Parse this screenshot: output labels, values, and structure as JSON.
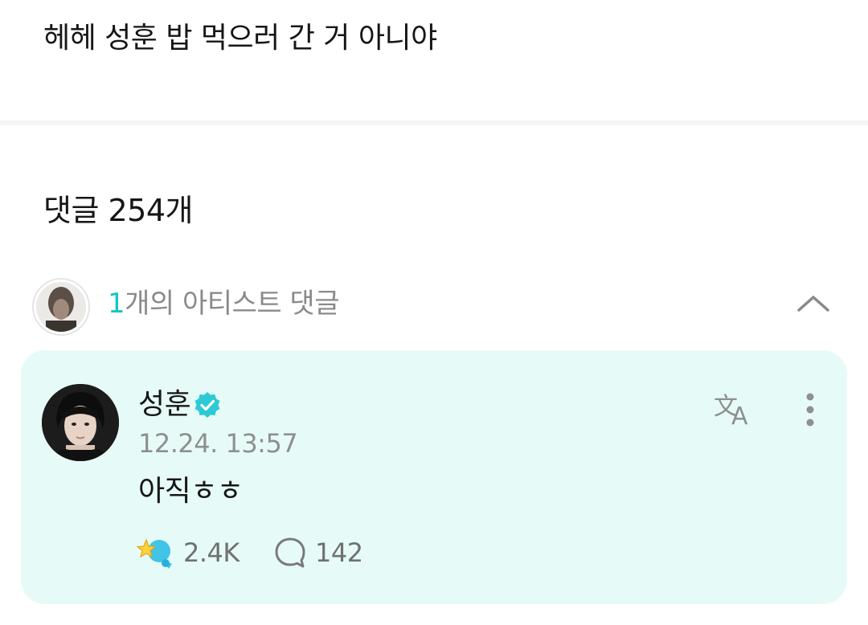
{
  "post": {
    "text": "헤헤 성훈 밥 먹으러 간 거 아니야"
  },
  "comments_section": {
    "header": "댓글 254개",
    "artist_group": {
      "count": "1",
      "label": "개의 아티스트 댓글"
    }
  },
  "artist_comment": {
    "author": "성훈",
    "timestamp": "12.24. 13:57",
    "body": "아직ㅎㅎ",
    "cheer_count": "2.4K",
    "reply_count": "142",
    "accent_color": "#12c6c6",
    "card_background": "#e6fbf7"
  },
  "icons": {
    "verified": "verified-check-icon",
    "translate": "translate-icon",
    "more": "more-vertical-icon",
    "collapse": "chevron-up-icon",
    "cheer": "cheer-icon",
    "reply": "speech-bubble-icon"
  }
}
